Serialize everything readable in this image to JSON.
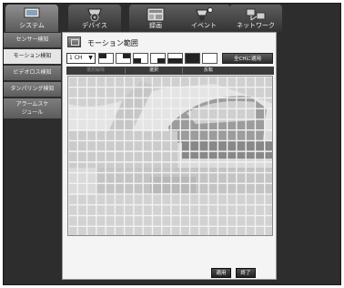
{
  "tabs": [
    {
      "label": "システム",
      "icon": "monitor-icon",
      "active": true
    },
    {
      "label": "デバイス",
      "icon": "camera-icon",
      "active": false
    },
    {
      "label": "録画",
      "icon": "record-icon",
      "active": false
    },
    {
      "label": "イベント",
      "icon": "camera-alert-icon",
      "active": false
    },
    {
      "label": "ネットワーク",
      "icon": "network-icon",
      "active": false
    }
  ],
  "sidebar": {
    "items": [
      {
        "label": "センサー検知",
        "active": false
      },
      {
        "label": "モーション検知",
        "active": true
      },
      {
        "label": "ビデオロス検知",
        "active": false
      },
      {
        "label": "タンパリング検知",
        "active": false
      },
      {
        "label": "アラームスケ\nジュール",
        "active": false
      }
    ]
  },
  "main": {
    "title": "モーション範囲",
    "channel": "1 CH",
    "select_all": "全CHに適用",
    "modes": [
      "選択解除",
      "選択",
      "反転"
    ],
    "apply": "適用",
    "close": "終了"
  },
  "colors": {
    "grid_line": "#f2f2f2",
    "frame": "#2d2d2d"
  }
}
